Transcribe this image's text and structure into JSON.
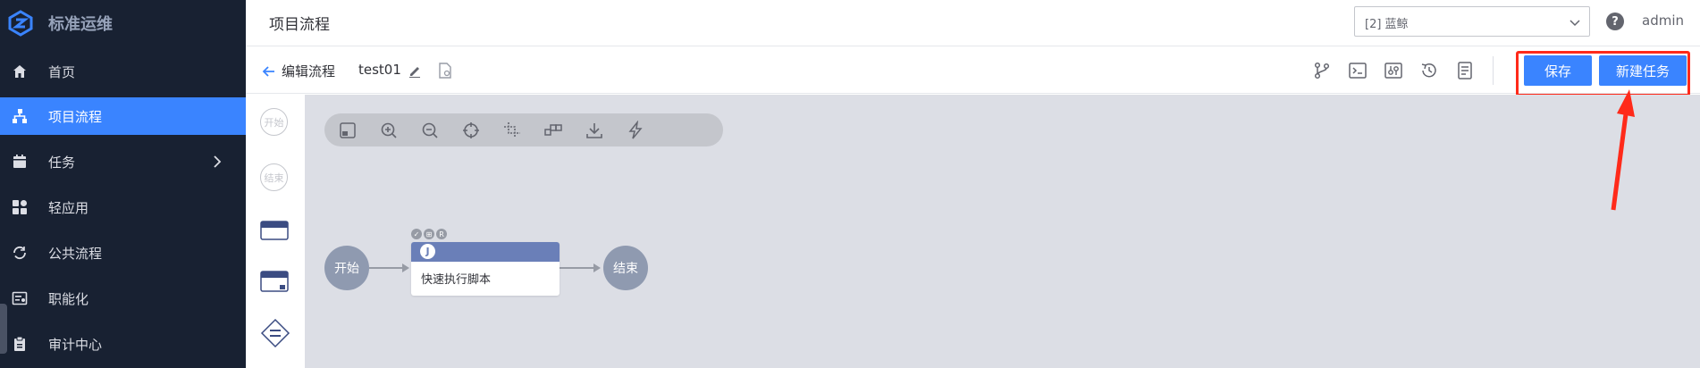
{
  "sidebar": {
    "brand": "标准运维",
    "items": [
      {
        "label": "首页",
        "icon": "home-icon"
      },
      {
        "label": "项目流程",
        "icon": "sitemap-icon",
        "active": true
      },
      {
        "label": "任务",
        "icon": "calendar-icon",
        "has_arrow": true
      },
      {
        "label": "轻应用",
        "icon": "apps-icon"
      },
      {
        "label": "公共流程",
        "icon": "refresh-icon"
      },
      {
        "label": "职能化",
        "icon": "list-card-icon"
      },
      {
        "label": "审计中心",
        "icon": "clipboard-icon"
      }
    ]
  },
  "header": {
    "title": "项目流程",
    "project_select": "[2] 蓝鲸",
    "help": "?",
    "user": "admin"
  },
  "toolbar": {
    "back_label": "编辑流程",
    "flow_name": "test01",
    "save_label": "保存",
    "new_task_label": "新建任务"
  },
  "palette": {
    "start_label": "开始",
    "end_label": "结束"
  },
  "canvas": {
    "start_node": "开始",
    "end_node": "结束",
    "task_node_label": "快速执行脚本",
    "task_type_glyph": "J",
    "badges": [
      "✓",
      "⊞",
      "R"
    ]
  },
  "colors": {
    "sidebar_bg": "#182132",
    "accent": "#3a84ff",
    "highlight": "#ff2a1a",
    "node_gray": "#8f9ab0",
    "task_header": "#6a7fb8"
  }
}
